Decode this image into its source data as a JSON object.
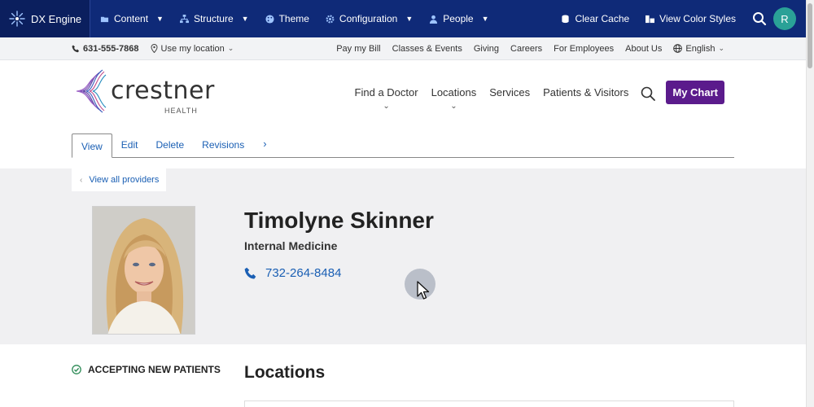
{
  "admin_bar": {
    "brand": "DX Engine",
    "menu": [
      {
        "label": "Content",
        "icon": "content-icon",
        "has_dropdown": true
      },
      {
        "label": "Structure",
        "icon": "structure-icon",
        "has_dropdown": true
      },
      {
        "label": "Theme",
        "icon": "palette-icon",
        "has_dropdown": false
      },
      {
        "label": "Configuration",
        "icon": "gear-icon",
        "has_dropdown": true
      },
      {
        "label": "People",
        "icon": "person-icon",
        "has_dropdown": true
      }
    ],
    "clear_cache": "Clear Cache",
    "view_color_styles": "View Color Styles",
    "avatar_initial": "R",
    "colors": {
      "background": "#0f2a78",
      "avatar": "#2aa197"
    }
  },
  "utility_bar": {
    "phone": "631-555-7868",
    "location": "Use my location",
    "links": [
      "Pay my Bill",
      "Classes & Events",
      "Giving",
      "Careers",
      "For Employees",
      "About Us"
    ],
    "language": "English"
  },
  "header": {
    "logo_word": "crestner",
    "logo_sub": "HEALTH",
    "nav": [
      {
        "label": "Find a Doctor",
        "has_dropdown": true
      },
      {
        "label": "Locations",
        "has_dropdown": true
      },
      {
        "label": "Services",
        "has_dropdown": false
      },
      {
        "label": "Patients & Visitors",
        "has_dropdown": false
      }
    ],
    "my_chart": "My Chart",
    "my_chart_color": "#5b1b8c"
  },
  "tabs": {
    "items": [
      "View",
      "Edit",
      "Delete",
      "Revisions"
    ],
    "active": "View"
  },
  "provider": {
    "back_link": "View all providers",
    "name": "Timolyne Skinner",
    "specialty": "Internal Medicine",
    "phone": "732-264-8484"
  },
  "details": {
    "accepting": "ACCEPTING NEW PATIENTS",
    "locations_title": "Locations"
  }
}
